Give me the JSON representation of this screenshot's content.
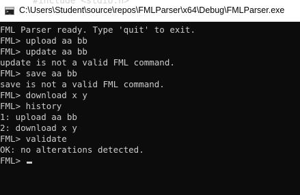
{
  "window": {
    "title": "C:\\Users\\Student\\source\\repos\\FMLParser\\x64\\Debug\\FMLParser.exe",
    "background_code": "#include <stdio.h>"
  },
  "console": {
    "lines": [
      "FML Parser ready. Type 'quit' to exit.",
      "FML> upload aa bb",
      "FML> update aa bb",
      "update is not a valid FML command.",
      "FML> save aa bb",
      "save is not a valid FML command.",
      "FML> download x y",
      "FML> history",
      "1: upload aa bb",
      "2: download x y",
      "FML> validate",
      "OK: no alterations detected."
    ],
    "prompt": "FML> "
  },
  "colors": {
    "console_bg": "#0c0c0c",
    "console_fg": "#cccccc",
    "titlebar_bg": "#ffffff"
  }
}
